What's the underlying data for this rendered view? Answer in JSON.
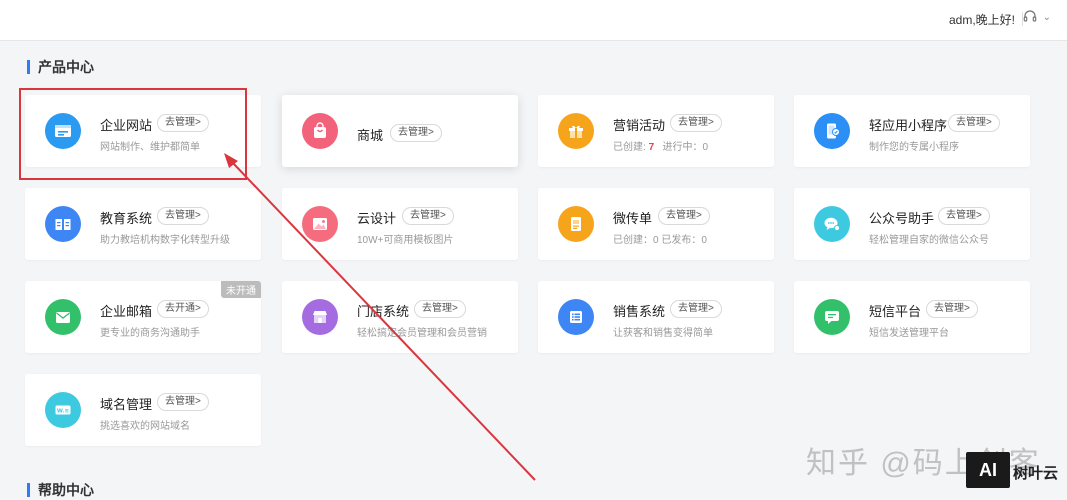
{
  "header": {
    "greeting": "adm,晚上好!",
    "support_icon": "headset-icon",
    "caret_icon": "chevron-down-icon"
  },
  "sections": {
    "product_center": "产品中心",
    "help_center": "帮助中心"
  },
  "cards": [
    {
      "name": "企业网站",
      "action": "去管理>",
      "desc": "网站制作、维护都简单",
      "icon": "website-icon",
      "color": "#2a9bf0"
    },
    {
      "name": "商城",
      "action": "去管理>",
      "desc": "",
      "icon": "shop-bag-icon",
      "color": "#f2627a"
    },
    {
      "name": "营销活动",
      "action": "去管理>",
      "desc_prefix": "已创建:",
      "desc_value": "7",
      "desc_suffix": "进行中：0",
      "icon": "gift-icon",
      "color": "#f7a41d"
    },
    {
      "name": "轻应用小程序",
      "action": "去管理>",
      "desc": "制作您的专属小程序",
      "icon": "mini-program-icon",
      "color": "#2b8ff5"
    },
    {
      "name": "教育系统",
      "action": "去管理>",
      "desc": "助力教培机构数字化转型升级",
      "icon": "book-icon",
      "color": "#3f86f5"
    },
    {
      "name": "云设计",
      "action": "去管理>",
      "desc": "10W+可商用模板图片",
      "icon": "image-icon",
      "color": "#f56c7e"
    },
    {
      "name": "微传单",
      "action": "去管理>",
      "desc": "已创建：0   已发布：0",
      "icon": "flyer-icon",
      "color": "#f7a41d"
    },
    {
      "name": "公众号助手",
      "action": "去管理>",
      "desc": "轻松管理自家的微信公众号",
      "icon": "wechat-icon",
      "color": "#3dc9e0"
    },
    {
      "name": "企业邮箱",
      "action": "去开通>",
      "desc": "更专业的商务沟通助手",
      "icon": "mail-icon",
      "color": "#33c06a",
      "badge": "未开通"
    },
    {
      "name": "门店系统",
      "action": "去管理>",
      "desc": "轻松搞定会员管理和会员营销",
      "icon": "store-icon",
      "color": "#a46ce0"
    },
    {
      "name": "销售系统",
      "action": "去管理>",
      "desc": "让获客和销售变得简单",
      "icon": "list-icon",
      "color": "#3f86f5"
    },
    {
      "name": "短信平台",
      "action": "去管理>",
      "desc": "短信发送管理平台",
      "icon": "sms-icon",
      "color": "#33c06a"
    },
    {
      "name": "域名管理",
      "action": "去管理>",
      "desc": "挑选喜欢的网站域名",
      "icon": "domain-icon",
      "color": "#3dc9e0"
    }
  ],
  "watermark": "知乎 @码上创客",
  "logo": {
    "mark": "AI",
    "text": "树叶云"
  },
  "colors": {
    "accent": "#2f7cf6",
    "highlight": "#d9363e"
  }
}
